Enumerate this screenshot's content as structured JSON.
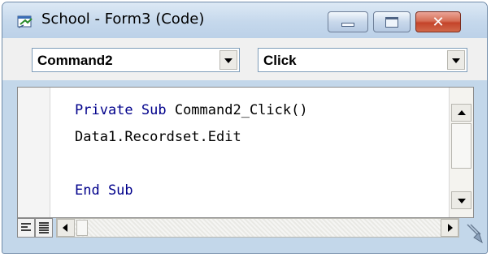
{
  "window": {
    "title": "School - Form3 (Code)",
    "icons": {
      "app": "vb-form-icon",
      "minimize": "minimize-icon",
      "maximize": "maximize-icon",
      "close": "close-icon"
    },
    "close_glyph": "✕"
  },
  "object_selector": {
    "selected": "Command2",
    "icon": "chevron-down-icon"
  },
  "procedure_selector": {
    "selected": "Click",
    "icon": "chevron-down-icon"
  },
  "code": {
    "line1_keyword": "Private Sub",
    "line1_name": " Command2_Click()",
    "line2": "Data1.Recordset.Edit",
    "line3": "",
    "line4_keyword": "End Sub"
  },
  "colors": {
    "keyword": "#00008b",
    "title_bar": "#c5d8ec",
    "close_button": "#c4442a"
  },
  "bottom_bar": {
    "view_icons": [
      "procedure-view-icon",
      "full-module-view-icon"
    ],
    "resize_icon": "resize-grip-icon"
  }
}
